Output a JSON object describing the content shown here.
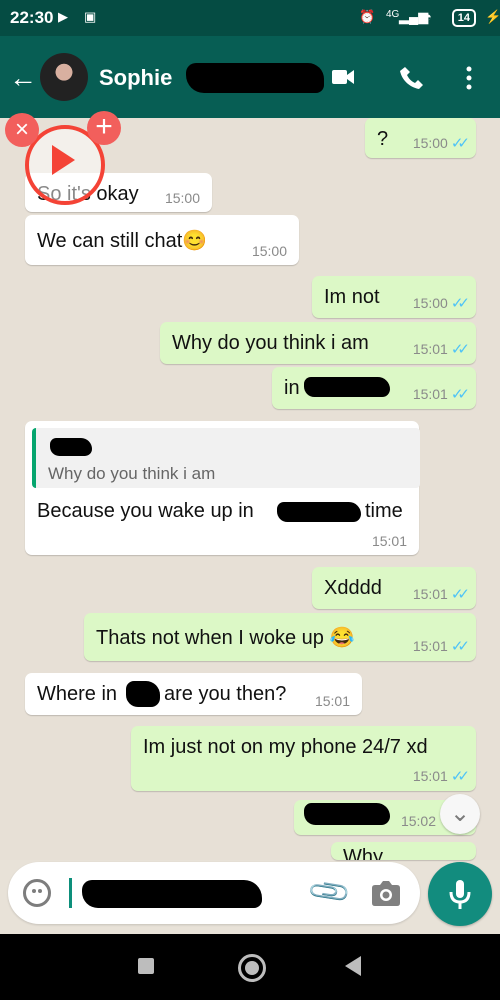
{
  "status_bar": {
    "time": "22:30",
    "network": "4G",
    "battery": "14"
  },
  "header": {
    "contact_name": "Sophie",
    "back_icon": "arrow-left-icon",
    "video_icon": "video-call-icon",
    "call_icon": "phone-icon",
    "menu_icon": "more-vertical-icon"
  },
  "messages": [
    {
      "direction": "out",
      "text": "?",
      "time": "15:00",
      "status": "read"
    },
    {
      "direction": "in",
      "text": "So it's okay",
      "time": "15:00"
    },
    {
      "direction": "in",
      "text": "We can still chat😊",
      "time": "15:00"
    },
    {
      "direction": "out",
      "text": "Im not",
      "time": "15:00",
      "status": "read"
    },
    {
      "direction": "out",
      "text": "Why do you think i am",
      "time": "15:01",
      "status": "read"
    },
    {
      "direction": "out",
      "text": "in",
      "time": "15:01",
      "status": "read"
    },
    {
      "direction": "in",
      "quote": "Why do you think i am",
      "text_before": "Because you wake up in",
      "text_after": "time",
      "time": "15:01"
    },
    {
      "direction": "out",
      "text": "Xdddd",
      "time": "15:01",
      "status": "read"
    },
    {
      "direction": "out",
      "text": "Thats not when I woke up 😂",
      "time": "15:01",
      "status": "read"
    },
    {
      "direction": "in",
      "text_before": "Where in",
      "text_after": "are you then?",
      "time": "15:01"
    },
    {
      "direction": "out",
      "text": "Im just not on my phone 24/7 xd",
      "time": "15:01",
      "status": "read"
    },
    {
      "direction": "out",
      "text": "",
      "time": "15:02",
      "status": "sent"
    },
    {
      "direction": "out",
      "text": "Why",
      "time": "",
      "status": "partial"
    }
  ],
  "composer": {
    "emoji_icon": "emoji-icon",
    "attach_icon": "paperclip-icon",
    "camera_icon": "camera-icon",
    "mic_icon": "microphone-icon"
  },
  "overlay": {
    "close_symbol": "×",
    "add_symbol": "+",
    "play_icon": "play-icon"
  },
  "scroll_down_symbol": "⌄",
  "colors": {
    "header": "#075e54",
    "status_bar": "#054c43",
    "outgoing_bubble": "#dcf8c6",
    "incoming_bubble": "#ffffff",
    "read_tick": "#4fc3f7",
    "accent": "#128c7e"
  }
}
